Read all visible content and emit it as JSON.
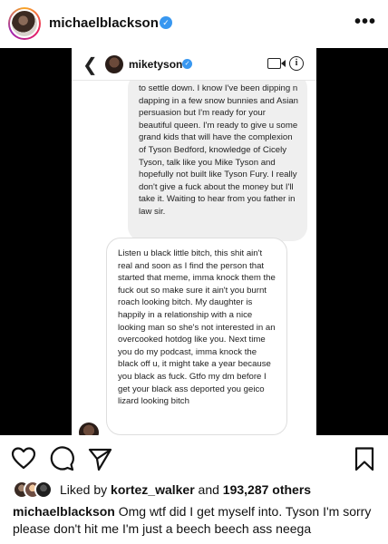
{
  "post": {
    "username": "michaelblackson",
    "verified_mark": "✓",
    "more_glyph": "•••",
    "icons": {
      "avatar": "profile-avatar",
      "verified": "verified-badge-icon",
      "more": "more-options-icon"
    }
  },
  "dm": {
    "back_glyph": "❮",
    "username": "miketyson",
    "verified_mark": "✓",
    "info_glyph": "i",
    "sent_message": "to settle down. I know I've been dipping n dapping in a few snow bunnies and Asian persuasion but I'm ready for your beautiful queen. I'm ready to give u some grand kids that will have the complexion of Tyson Bedford, knowledge of Cicely Tyson, talk like you Mike Tyson and hopefully not built like Tyson Fury. I really don't give a fuck about the money but I'll take it. Waiting to hear from you father in law sir.",
    "received_message": "Listen u black little bitch, this shit ain't real and soon as I find the person that started that meme, imma knock them the fuck out so make sure it ain't you burnt roach looking bitch. My daughter is happily in a relationship with a nice looking man so she's not interested in an overcooked hotdog like you. Next time you do my podcast, imma knock the black off u, it might take a year because you black as fuck. Gtfo my dm before I get your black ass deported you geico lizard looking bitch",
    "colors": {
      "sent_bubble": "#efefef",
      "received_bubble": "#ffffff"
    }
  },
  "actions": {
    "like": "heart-icon",
    "comment": "comment-icon",
    "share": "share-icon",
    "save": "bookmark-icon"
  },
  "likes": {
    "prefix": "Liked by",
    "first_liker": "kortez_walker",
    "middle": "and",
    "count": "193,287 others"
  },
  "caption": {
    "username": "michaelblackson",
    "text": "Omg wtf did I get myself into. Tyson I'm sorry please don't hit me I'm just a beech beech ass neega"
  },
  "colors": {
    "verified": "#3897f0",
    "text": "#111111",
    "image_background": "#000000"
  }
}
